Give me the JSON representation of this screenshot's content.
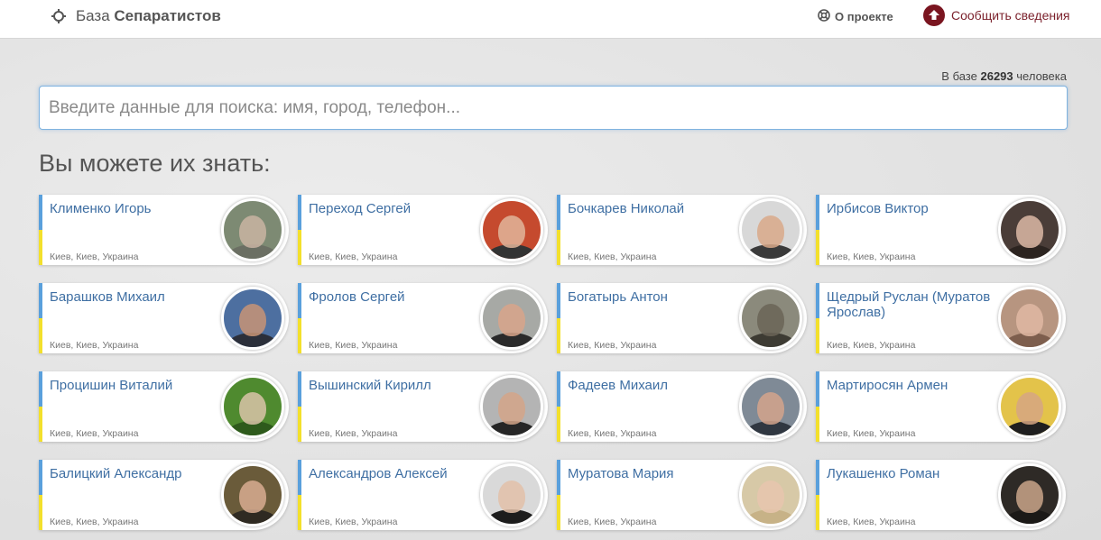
{
  "header": {
    "brand_prefix": "База",
    "brand_bold": "Сепаратистов",
    "about_label": "О проекте",
    "report_label": "Сообщить сведения",
    "brand_icon": "crosshair-icon",
    "about_icon": "lifebuoy-icon",
    "report_icon": "upload-arrow-icon"
  },
  "stats": {
    "prefix": "В базе",
    "number": "26293",
    "suffix": "человека"
  },
  "search": {
    "placeholder": "Введите данные для поиска: имя, город, телефон..."
  },
  "section_title": "Вы можете их знать:",
  "people": [
    {
      "name": "Клименко Игорь",
      "location": "Киев, Киев, Украина",
      "bg": "#7d8a73",
      "face": "#c9b4a2",
      "body": "#6b6f63"
    },
    {
      "name": "Переход Сергей",
      "location": "Киев, Киев, Украина",
      "bg": "#c54a2e",
      "face": "#e0b59a",
      "body": "#333333"
    },
    {
      "name": "Бочкарев Николай",
      "location": "Киев, Киев, Украина",
      "bg": "#d8d8d8",
      "face": "#d9a98a",
      "body": "#3a3a3a"
    },
    {
      "name": "Ирбисов Виктор",
      "location": "Киев, Киев, Украина",
      "bg": "#4a3d38",
      "face": "#dcb8a6",
      "body": "#2c2420"
    },
    {
      "name": "Барашков Михаил",
      "location": "Киев, Киев, Украина",
      "bg": "#4d6fa0",
      "face": "#c89476",
      "body": "#2b2f3a"
    },
    {
      "name": "Фролов Сергей",
      "location": "Киев, Киев, Украина",
      "bg": "#a7a9a5",
      "face": "#d8a48a",
      "body": "#2a2a2a"
    },
    {
      "name": "Богатырь Антон",
      "location": "Киев, Киев, Украина",
      "bg": "#8b8a7c",
      "face": "#6a6457",
      "body": "#3d3b33"
    },
    {
      "name": "Щедрый Руслан (Муратов Ярослав)",
      "location": "Киев, Киев, Украина",
      "bg": "#b79580",
      "face": "#e1b9a3",
      "body": "#7d5e4d"
    },
    {
      "name": "Процишин Виталий",
      "location": "Киев, Киев, Украина",
      "bg": "#4f8a2f",
      "face": "#d9c3a8",
      "body": "#2e5a1c"
    },
    {
      "name": "Вышинский Кирилл",
      "location": "Киев, Киев, Украина",
      "bg": "#b4b4b4",
      "face": "#d3a488",
      "body": "#262626"
    },
    {
      "name": "Фадеев Михаил",
      "location": "Киев, Киев, Украина",
      "bg": "#7f8a96",
      "face": "#d4a38c",
      "body": "#303741"
    },
    {
      "name": "Мартиросян Армен",
      "location": "Киев, Киев, Украина",
      "bg": "#e3c34a",
      "face": "#d6a682",
      "body": "#1f1f1f"
    },
    {
      "name": "Балицкий Александр",
      "location": "Киев, Киев, Украина",
      "bg": "#6a5b3a",
      "face": "#d8ad92",
      "body": "#2f2a22"
    },
    {
      "name": "Александров Алексей",
      "location": "Киев, Киев, Украина",
      "bg": "#d9d9d9",
      "face": "#e2c0a8",
      "body": "#1d1d1d"
    },
    {
      "name": "Муратова Мария",
      "location": "Киев, Киев, Украина",
      "bg": "#d7c9a7",
      "face": "#e8c6ae",
      "body": "#c7b287"
    },
    {
      "name": "Лукашенко Роман",
      "location": "Киев, Киев, Украина",
      "bg": "#2e2a26",
      "face": "#c9a48a",
      "body": "#1b1917"
    }
  ]
}
